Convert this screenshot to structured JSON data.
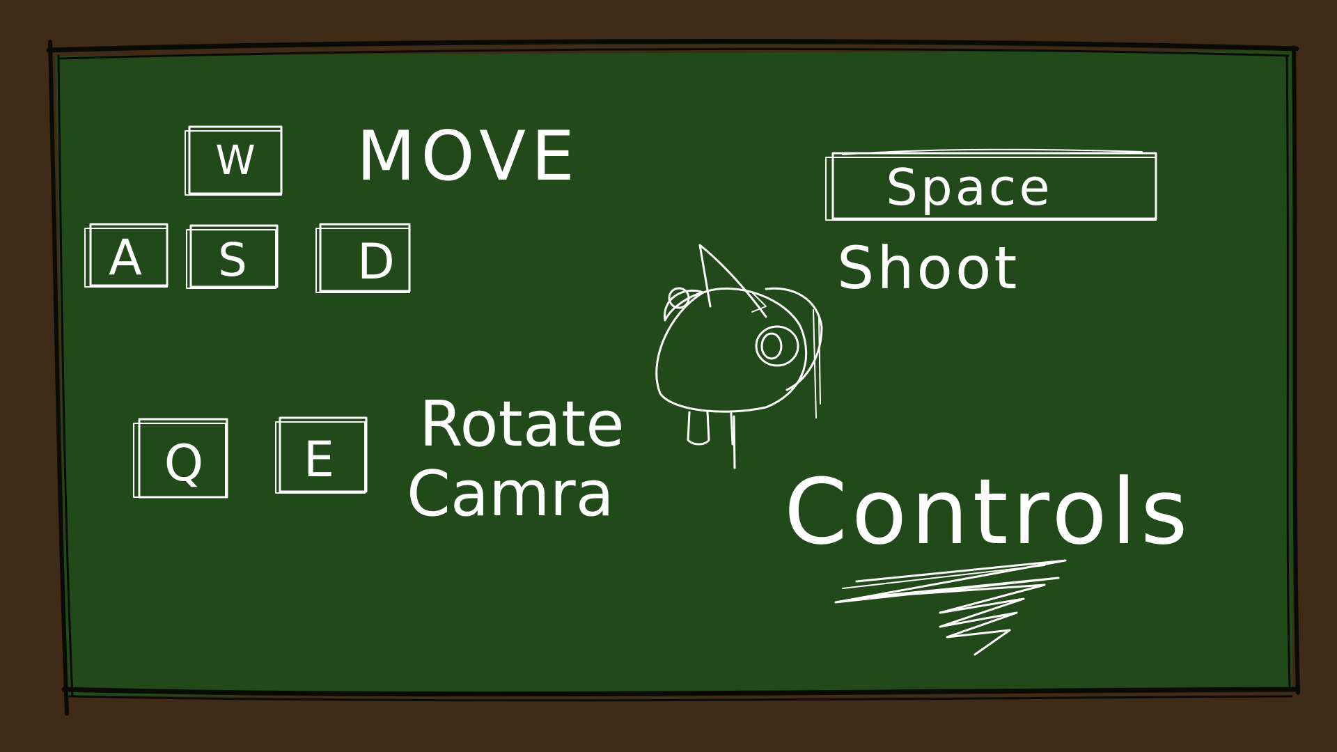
{
  "colors": {
    "background": "#3f2b17",
    "board": "#22491a",
    "frame": "#0b0b06",
    "chalk": "#ffffff"
  },
  "controls": {
    "title": "Controls",
    "move": {
      "keys": [
        "W",
        "A",
        "S",
        "D"
      ],
      "label": "MOVE"
    },
    "rotate": {
      "keys": [
        "Q",
        "E"
      ],
      "label_line1": "Rotate",
      "label_line2": "Camra"
    },
    "shoot": {
      "key": "Space",
      "label": "Shoot"
    }
  },
  "icons": {
    "mascot": "chalk-bird-creature-icon",
    "underline": "chalk-scribble-underline-icon"
  }
}
